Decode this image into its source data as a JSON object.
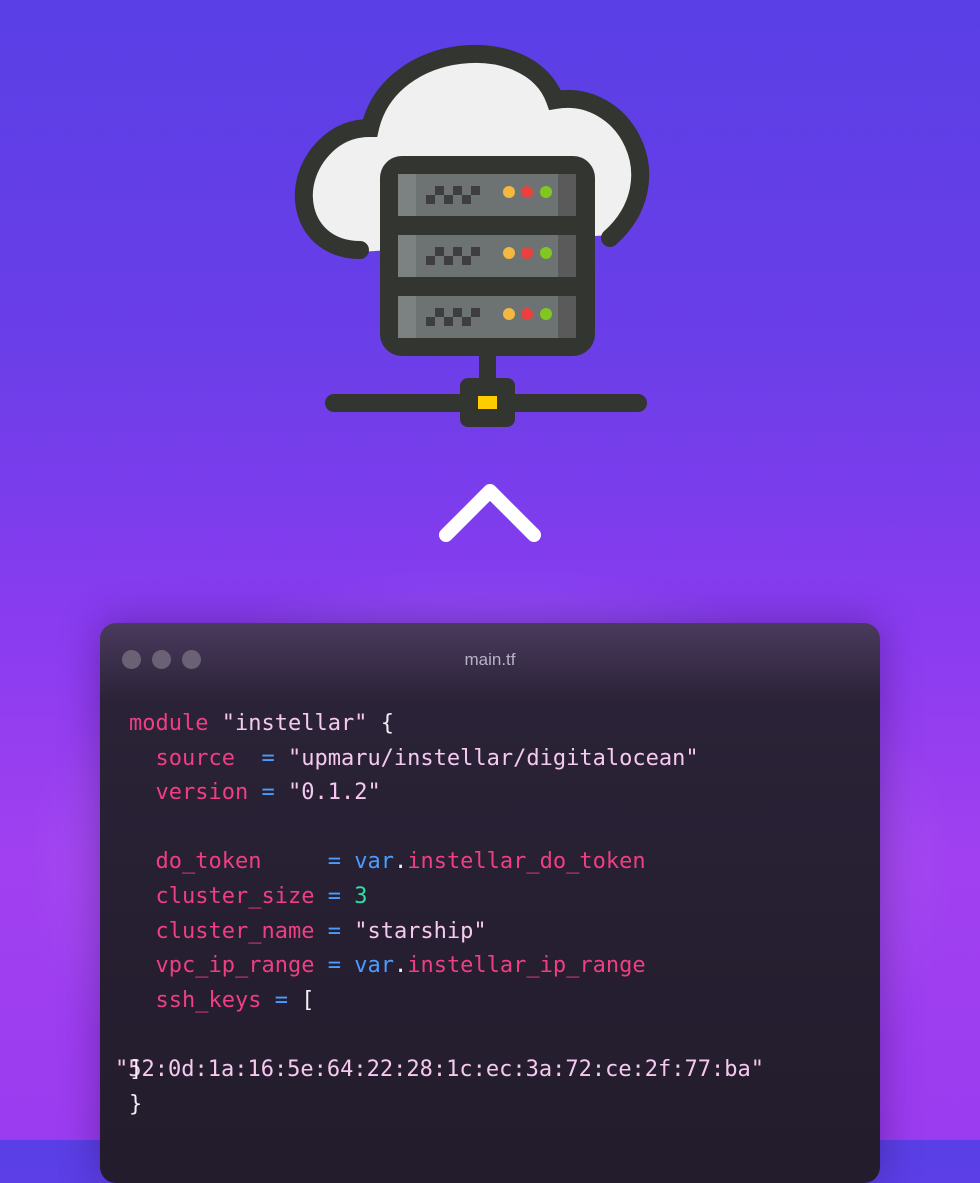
{
  "window": {
    "title": "main.tf",
    "controls": [
      "close",
      "minimize",
      "zoom"
    ]
  },
  "hero": {
    "icon": "cloud-server-icon",
    "arrow": "chevron-up-icon"
  },
  "code": {
    "l1": {
      "kw": "module",
      "name": "\"instellar\"",
      "brace": "{"
    },
    "l2": {
      "key": "source ",
      "eq": "=",
      "val": "\"upmaru/instellar/digitalocean\""
    },
    "l3": {
      "key": "version",
      "eq": "=",
      "val": "\"0.1.2\""
    },
    "l4": {
      "key": "do_token    ",
      "eq": "=",
      "var": "var",
      "dot": ".",
      "ref": "instellar_do_token"
    },
    "l5": {
      "key": "cluster_size",
      "eq": "=",
      "num": "3"
    },
    "l6": {
      "key": "cluster_name",
      "eq": "=",
      "val": "\"starship\""
    },
    "l7": {
      "key": "vpc_ip_range",
      "eq": "=",
      "var": "var",
      "dot": ".",
      "ref": "instellar_ip_range"
    },
    "l8": {
      "key": "ssh_keys",
      "eq": "=",
      "open": "["
    },
    "l9": {
      "val": "\"52:0d:1a:16:5e:64:22:28:1c:ec:3a:72:ce:2f:77:ba\"",
      "close": "]"
    },
    "l10": {
      "brace": "}"
    }
  },
  "colors": {
    "keyword": "#f03e82",
    "string": "#f6c9ef",
    "operator": "#4a9dff",
    "number": "#2ee0a4"
  }
}
